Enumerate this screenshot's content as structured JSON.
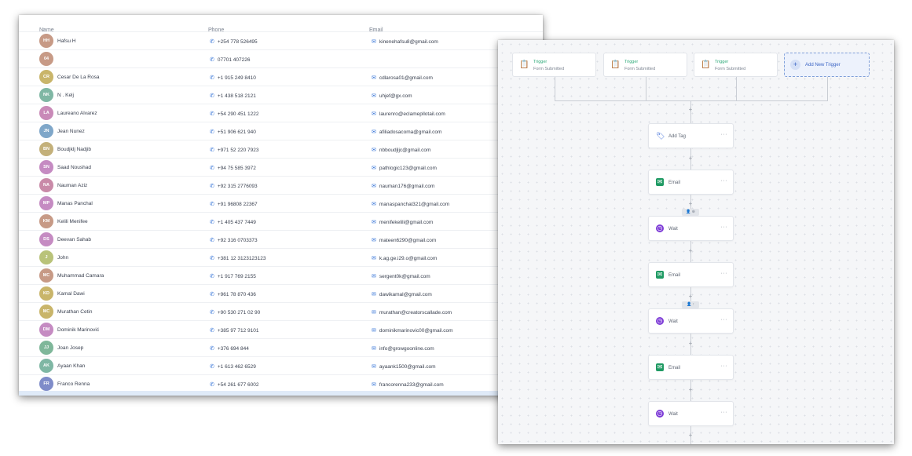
{
  "contacts": {
    "headers": {
      "name": "Name",
      "phone": "Phone",
      "email": "Email"
    },
    "rows": [
      {
        "initials": "HH",
        "name": "Hafsu H",
        "phone": "+254 778 526495",
        "email": "kinenehafsu8@gmail.com",
        "color": "#c79a86"
      },
      {
        "initials": "04",
        "name": "",
        "phone": "07701 407226",
        "email": "",
        "color": "#c79a86"
      },
      {
        "initials": "CR",
        "name": "Cesar De La Rosa",
        "phone": "+1 915 249 8410",
        "email": "cdlarosa01@gmail.com",
        "color": "#c9b56a"
      },
      {
        "initials": "NK",
        "name": "N . Kelj",
        "phone": "+1 438 518 2121",
        "email": "uhjef@gx.com",
        "color": "#7fb7a4"
      },
      {
        "initials": "LA",
        "name": "Laureano Alvarez",
        "phone": "+54 290 451 1222",
        "email": "laurenro@eclamepllotail.com",
        "color": "#c98ab8"
      },
      {
        "initials": "JN",
        "name": "Jean Nunez",
        "phone": "+51 906 621 940",
        "email": "afiliadosacoma@gmail.com",
        "color": "#7fa7c9"
      },
      {
        "initials": "BN",
        "name": "Boudjklj Nadjib",
        "phone": "+971 52 220 7923",
        "email": "nbboudjljc@gmail.com",
        "color": "#c3b07a"
      },
      {
        "initials": "SN",
        "name": "Saad Noushad",
        "phone": "+94 75 585 3972",
        "email": "pathlogic123@gmail.com",
        "color": "#c58bc2"
      },
      {
        "initials": "NA",
        "name": "Nauman Aziz",
        "phone": "+92 315 2776093",
        "email": "nauman176@gmail.com",
        "color": "#c98aa8"
      },
      {
        "initials": "MP",
        "name": "Manas Panchal",
        "phone": "+91 96808 22367",
        "email": "manaspanchal321@gmail.com",
        "color": "#c58bc2"
      },
      {
        "initials": "KM",
        "name": "Kelili Menifee",
        "phone": "+1 405 437 7449",
        "email": "menifekelili@gmail.com",
        "color": "#c79a86"
      },
      {
        "initials": "DS",
        "name": "Deevan Sahab",
        "phone": "+92 316 0703373",
        "email": "mateen6290@gmail.com",
        "color": "#c58bc2"
      },
      {
        "initials": "J",
        "name": "John",
        "phone": "+381 12 3123123123",
        "email": "k.ag.ge.i29.o@gmail.com",
        "color": "#b9c37a"
      },
      {
        "initials": "MC",
        "name": "Muhammad Camara",
        "phone": "+1 917 769 2155",
        "email": "sergent0k@gmail.com",
        "color": "#c79a86"
      },
      {
        "initials": "KD",
        "name": "Kamal Dawi",
        "phone": "+961 78 870 436",
        "email": "dawikamal@gmail.com",
        "color": "#c9b56a"
      },
      {
        "initials": "MC",
        "name": "Murathan Cetin",
        "phone": "+90 530 271 02 90",
        "email": "murathan@creatorscallade.com",
        "color": "#c9b56a"
      },
      {
        "initials": "DM",
        "name": "Dominik Marinović",
        "phone": "+385 97 712 9101",
        "email": "dominikmarinovic00@gmail.com",
        "color": "#c58bc2"
      },
      {
        "initials": "JJ",
        "name": "Joan Josep",
        "phone": "+376 694 844",
        "email": "info@growgoonline.com",
        "color": "#7fb79a"
      },
      {
        "initials": "AK",
        "name": "Ayaan Khan",
        "phone": "+1 613 462 6529",
        "email": "ayaank1500@gmail.com",
        "color": "#7fb7a4"
      },
      {
        "initials": "FR",
        "name": "Franco Renna",
        "phone": "+54 261 677 6002",
        "email": "francorenna233@gmail.com",
        "color": "#7f8cc9"
      }
    ]
  },
  "workflow": {
    "triggers": [
      {
        "title": "Trigger",
        "subtitle": "Form Submitted"
      },
      {
        "title": "Trigger",
        "subtitle": "Form Submitted"
      },
      {
        "title": "Trigger",
        "subtitle": "Form Submitted"
      }
    ],
    "add_trigger_label": "Add New Trigger",
    "plus": "+",
    "chips": [
      {
        "label": "👤 ⊕"
      },
      {
        "label": "👤 ↑"
      }
    ],
    "actions": [
      {
        "label": "Add Tag",
        "icon": "tag-icon",
        "more": "···"
      },
      {
        "label": "Email",
        "icon": "email-icon",
        "more": "···"
      },
      {
        "label": "Wait",
        "icon": "clock-icon",
        "more": "···"
      },
      {
        "label": "Email",
        "icon": "email-icon",
        "more": "···"
      },
      {
        "label": "Wait",
        "icon": "clock-icon",
        "more": "···"
      },
      {
        "label": "Email",
        "icon": "email-icon",
        "more": "···"
      },
      {
        "label": "Wait",
        "icon": "clock-icon",
        "more": "···"
      }
    ]
  }
}
